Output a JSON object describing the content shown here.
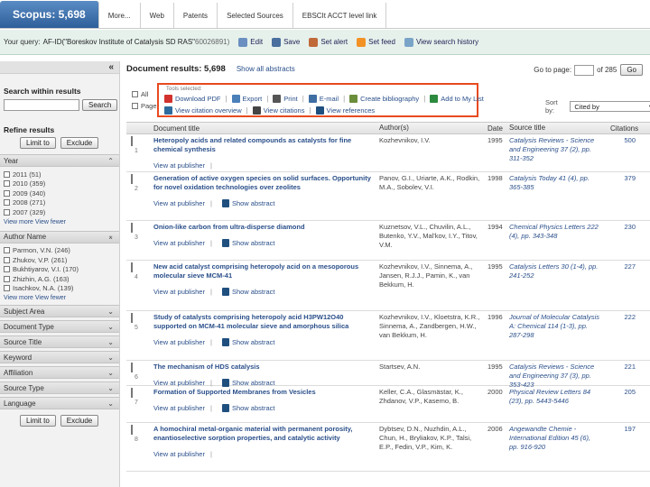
{
  "tabs": [
    {
      "label": "Scopus: 5,698",
      "active": true
    },
    {
      "label": "More..."
    },
    {
      "label": "Web"
    },
    {
      "label": "Patents"
    },
    {
      "label": "Selected Sources"
    },
    {
      "label": "EBSCIt ACCT level link"
    }
  ],
  "query": {
    "label": "Your query:",
    "text": "AF-ID(\"Boreskov Institute of Catalysis SD RAS\"",
    "count": "60026891)",
    "actions": [
      "Edit",
      "Save",
      "Set alert",
      "Set feed",
      "View search history"
    ]
  },
  "sidebar": {
    "collapse_glyph": "«",
    "search_title": "Search within results",
    "search_button": "Search",
    "refine_title": "Refine results",
    "limit_button": "Limit to",
    "exclude_button": "Exclude",
    "year": {
      "title": "Year",
      "toggle": "⌃",
      "items": [
        "2011 (51)",
        "2010 (359)",
        "2009 (340)",
        "2008 (271)",
        "2007 (329)"
      ],
      "links": "View more  View fewer"
    },
    "author": {
      "title": "Author Name",
      "toggle": "⌅",
      "items": [
        "Parmon, V.N. (246)",
        "Zhukov, V.P. (261)",
        "Bukhtiyarov, V.I. (170)",
        "Zhizhin, A.G. (163)",
        "Isachkov, N.A. (139)"
      ],
      "links": "View more  View fewer"
    },
    "collapsed": [
      {
        "title": "Subject Area",
        "toggle": "⌄"
      },
      {
        "title": "Document Type",
        "toggle": "⌄"
      },
      {
        "title": "Source Title",
        "toggle": "⌄"
      },
      {
        "title": "Keyword",
        "toggle": "⌄"
      },
      {
        "title": "Affiliation",
        "toggle": "⌄"
      },
      {
        "title": "Source Type",
        "toggle": "⌄"
      },
      {
        "title": "Language",
        "toggle": "⌄"
      }
    ],
    "limit_button2": "Limit to",
    "exclude_button2": "Exclude"
  },
  "main": {
    "title": "Document results: 5,698",
    "show_abstracts": "Show all abstracts",
    "goto_label": "Go to page:",
    "goto_of": "of 285",
    "goto_button": "Go",
    "select_all": "All",
    "select_page": "Page",
    "toolbox_caption": "Tools selected:",
    "tools_row1": [
      "Download PDF",
      "Export",
      "Print",
      "E-mail",
      "Create bibliography",
      "Add to My List"
    ],
    "tools_row2": [
      "View citation overview",
      "View citations",
      "View references"
    ],
    "sort_label": "Sort by:",
    "sort_value": "Cited by"
  },
  "table": {
    "headers": {
      "title": "Document title",
      "authors": "Author(s)",
      "date": "Date",
      "source": "Source title",
      "citations": "Citations"
    },
    "view_at_publisher": "View at publisher",
    "show_abstract": "Show abstract",
    "rows": [
      {
        "num": "1",
        "title": "Heteropoly acids and related compounds as catalysts for fine chemical synthesis",
        "authors": "Kozhevnikov, I.V.",
        "year": "1995",
        "source": "Catalysis Reviews - Science and Engineering 37 (2), pp. 311-352",
        "cites": "500",
        "abs": false
      },
      {
        "num": "2",
        "title": "Generation of active oxygen species on solid surfaces. Opportunity for novel oxidation technologies over zeolites",
        "authors": "Panov, G.I., Uriarte, A.K., Rodkin, M.A., Sobolev, V.I.",
        "year": "1998",
        "source": "Catalysis Today 41 (4), pp. 365-385",
        "cites": "379",
        "abs": true
      },
      {
        "num": "3",
        "title": "Onion-like carbon from ultra-disperse diamond",
        "authors": "Kuznetsov, V.L., Chuvilin, A.L., Butenko, Y.V., Mal'kov, I.Y., Titov, V.M.",
        "year": "1994",
        "source": "Chemical Physics Letters 222 (4), pp. 343-348",
        "cites": "230",
        "abs": true
      },
      {
        "num": "4",
        "title": "New acid catalyst comprising heteropoly acid on a mesoporous molecular sieve MCM-41",
        "authors": "Kozhevnikov, I.V., Sinnema, A., Jansen, R.J.J., Pamin, K., van Bekkum, H.",
        "year": "1995",
        "source": "Catalysis Letters 30 (1-4), pp. 241-252",
        "cites": "227",
        "abs": true
      },
      {
        "num": "5",
        "title": "Study of catalysts comprising heteropoly acid H3PW12O40 supported on MCM-41 molecular sieve and amorphous silica",
        "authors": "Kozhevnikov, I.V., Kloetstra, K.R., Sinnema, A., Zandbergen, H.W., van Bekkum, H.",
        "year": "1996",
        "source": "Journal of Molecular Catalysis A: Chemical 114 (1-3), pp. 287-298",
        "cites": "222",
        "abs": true
      },
      {
        "num": "6",
        "title": "The mechanism of HDS catalysis",
        "authors": "Startsev, A.N.",
        "year": "1995",
        "source": "Catalysis Reviews - Science and Engineering 37 (3), pp. 353-423",
        "cites": "221",
        "abs": true
      },
      {
        "num": "7",
        "title": "Formation of Supported Membranes from Vesicles",
        "authors": "Keller, C.A., Glasmästar, K., Zhdanov, V.P., Kasemo, B.",
        "year": "2000",
        "source": "Physical Review Letters 84 (23), pp. 5443-5446",
        "cites": "205",
        "abs": true
      },
      {
        "num": "8",
        "title": "A homochiral metal-organic material with permanent porosity, enantioselective sorption properties, and catalytic activity",
        "authors": "Dybtsev, D.N., Nuzhdin, A.L., Chun, H., Bryliakov, K.P., Talsi, E.P., Fedin, V.P., Kim, K.",
        "year": "2006",
        "source": "Angewandte Chemie - International Edition 45 (6), pp. 916-920",
        "cites": "197",
        "abs": false
      }
    ]
  },
  "colors": {
    "accent": "#2f5f9a",
    "highlight_box": "#e84a1f",
    "query_bar": "#e6f1ec",
    "link": "#2a4f8a"
  }
}
